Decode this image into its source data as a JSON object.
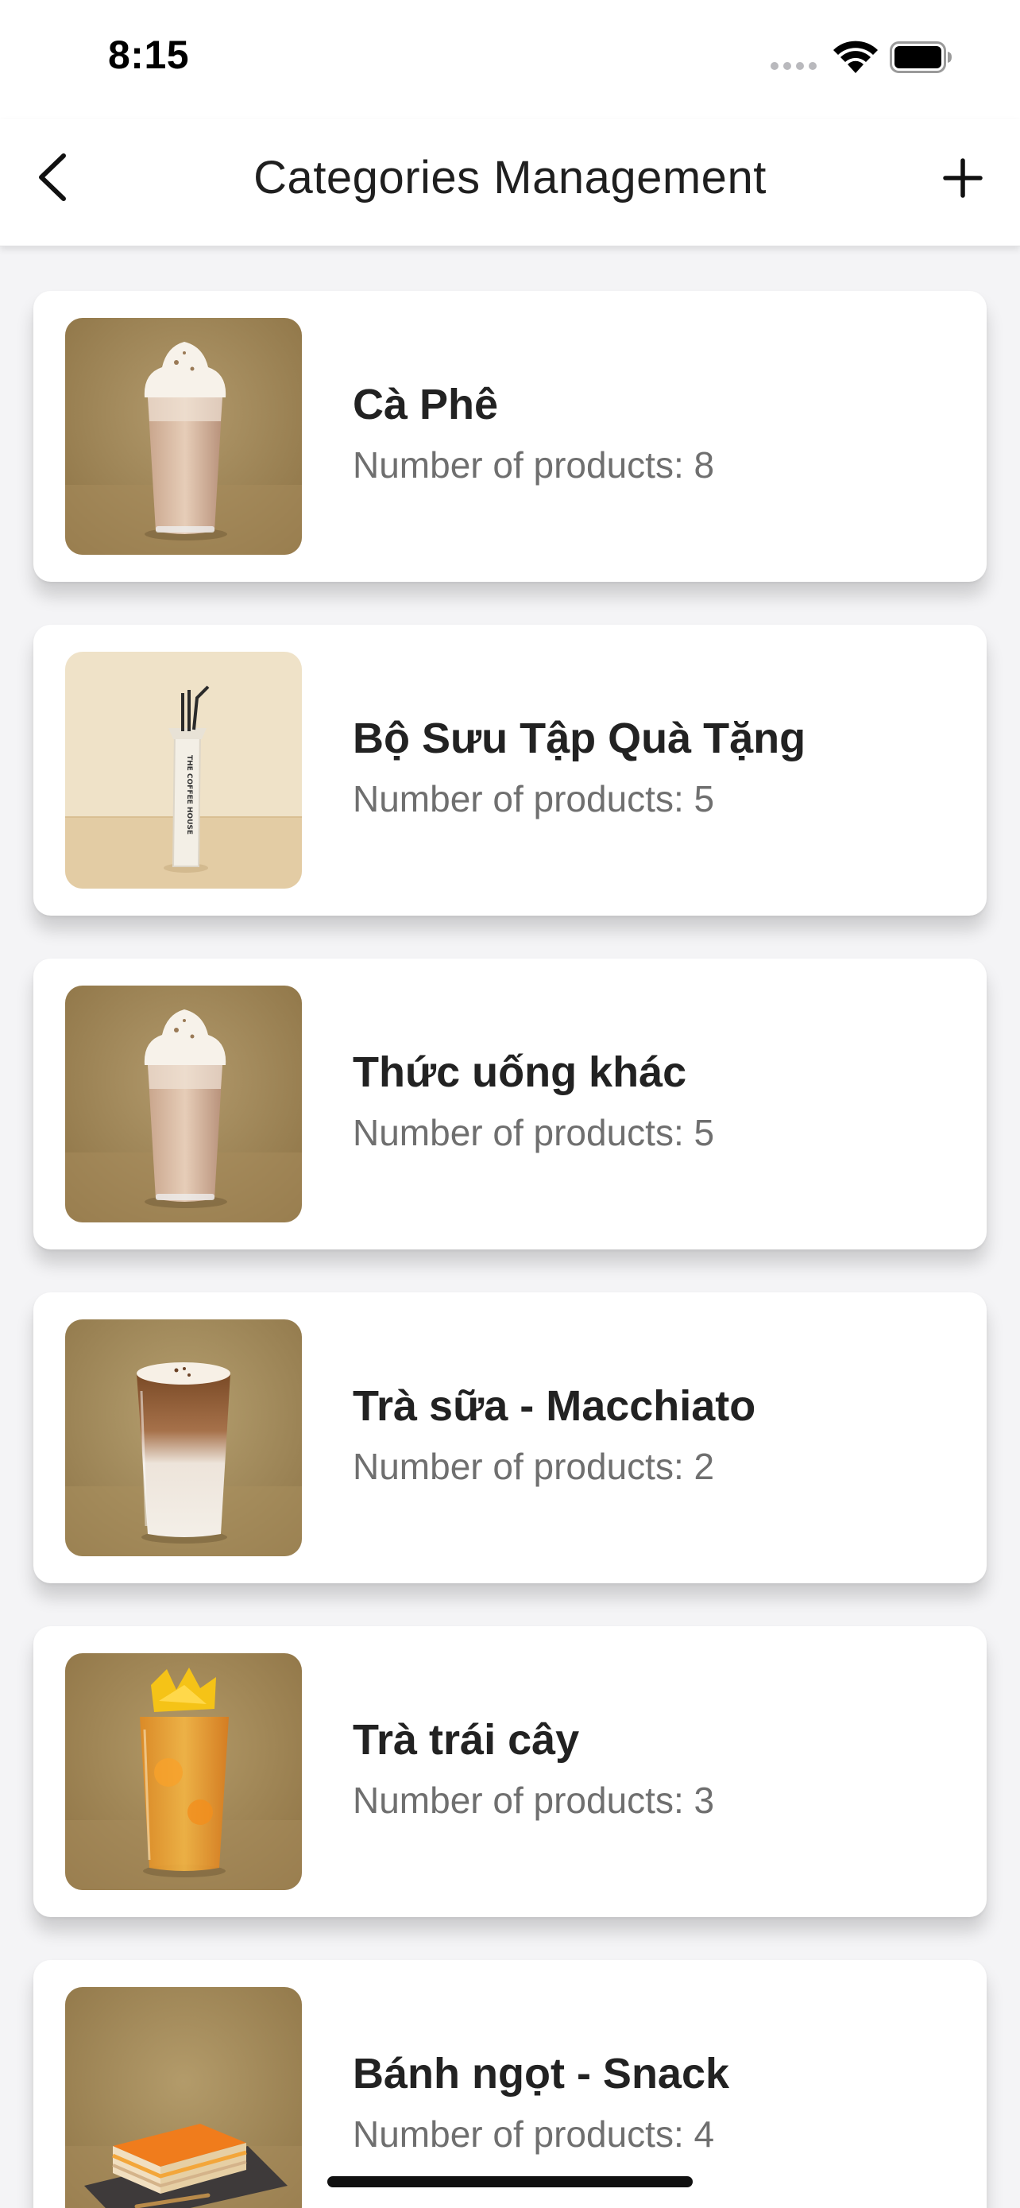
{
  "status_bar": {
    "time": "8:15"
  },
  "nav": {
    "title": "Categories Management",
    "back_icon": "chevron-left-icon",
    "add_icon": "plus-icon"
  },
  "categories": [
    {
      "name": "Cà Phê",
      "count_text": "Number of products: 8",
      "image": "frappe-drink"
    },
    {
      "name": "Bộ Sưu Tập Quà Tặng",
      "count_text": "Number of products: 5",
      "image": "straw-gift-bag"
    },
    {
      "name": "Thức uống khác",
      "count_text": "Number of products: 5",
      "image": "frappe-drink"
    },
    {
      "name": "Trà sữa - Macchiato",
      "count_text": "Number of products: 2",
      "image": "layered-latte"
    },
    {
      "name": "Trà trái cây",
      "count_text": "Number of products: 3",
      "image": "fruit-tea"
    },
    {
      "name": "Bánh ngọt - Snack",
      "count_text": "Number of products: 4",
      "image": "cake-slice"
    }
  ]
}
